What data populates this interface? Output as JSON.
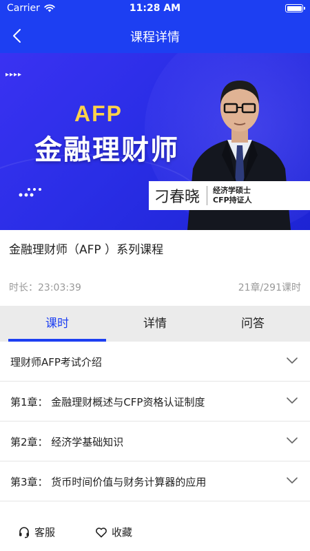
{
  "status_bar": {
    "carrier": "Carrier",
    "time": "11:28 AM",
    "icons": [
      "wifi-icon",
      "battery-icon"
    ]
  },
  "nav": {
    "title": "课程详情",
    "back_icon": "chevron-left-icon"
  },
  "banner": {
    "play_arrows": "▸▸▸▸",
    "subject": "AFP",
    "title": "金融理财师",
    "teacher_name": "刁春晓",
    "teacher_credentials": [
      "经济学硕士",
      "CFP持证人"
    ],
    "accent_color": "#ffd24a"
  },
  "course": {
    "title": "金融理财师（AFP ）系列课程",
    "duration": "时长：23:03:39",
    "lesson_count": "21章/291课时"
  },
  "tabs": [
    {
      "label": "课时",
      "active": true
    },
    {
      "label": "详情",
      "active": false
    },
    {
      "label": "问答",
      "active": false
    }
  ],
  "chapters": [
    {
      "label": "理财师AFP考试介绍"
    },
    {
      "label": "第1章：  金融理财概述与CFP资格认证制度"
    },
    {
      "label": "第2章：  经济学基础知识"
    },
    {
      "label": "第3章：  货币时间价值与财务计算器的应用"
    }
  ],
  "bottom_bar": {
    "service_label": "客服",
    "favorite_label": "收藏",
    "service_icon": "headset-icon",
    "favorite_icon": "heart-icon"
  },
  "colors": {
    "primary": "#1d3ff2",
    "tab_background": "#ebebeb"
  }
}
